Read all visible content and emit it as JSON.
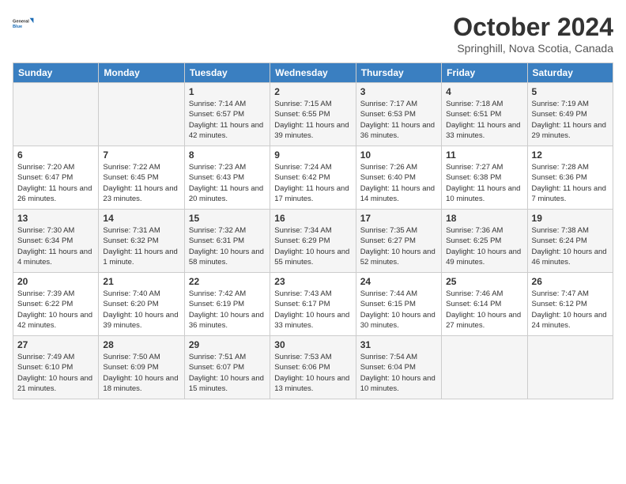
{
  "logo": {
    "line1": "General",
    "line2": "Blue"
  },
  "title": "October 2024",
  "subtitle": "Springhill, Nova Scotia, Canada",
  "days_of_week": [
    "Sunday",
    "Monday",
    "Tuesday",
    "Wednesday",
    "Thursday",
    "Friday",
    "Saturday"
  ],
  "weeks": [
    [
      {
        "day": "",
        "sunrise": "",
        "sunset": "",
        "daylight": ""
      },
      {
        "day": "",
        "sunrise": "",
        "sunset": "",
        "daylight": ""
      },
      {
        "day": "1",
        "sunrise": "Sunrise: 7:14 AM",
        "sunset": "Sunset: 6:57 PM",
        "daylight": "Daylight: 11 hours and 42 minutes."
      },
      {
        "day": "2",
        "sunrise": "Sunrise: 7:15 AM",
        "sunset": "Sunset: 6:55 PM",
        "daylight": "Daylight: 11 hours and 39 minutes."
      },
      {
        "day": "3",
        "sunrise": "Sunrise: 7:17 AM",
        "sunset": "Sunset: 6:53 PM",
        "daylight": "Daylight: 11 hours and 36 minutes."
      },
      {
        "day": "4",
        "sunrise": "Sunrise: 7:18 AM",
        "sunset": "Sunset: 6:51 PM",
        "daylight": "Daylight: 11 hours and 33 minutes."
      },
      {
        "day": "5",
        "sunrise": "Sunrise: 7:19 AM",
        "sunset": "Sunset: 6:49 PM",
        "daylight": "Daylight: 11 hours and 29 minutes."
      }
    ],
    [
      {
        "day": "6",
        "sunrise": "Sunrise: 7:20 AM",
        "sunset": "Sunset: 6:47 PM",
        "daylight": "Daylight: 11 hours and 26 minutes."
      },
      {
        "day": "7",
        "sunrise": "Sunrise: 7:22 AM",
        "sunset": "Sunset: 6:45 PM",
        "daylight": "Daylight: 11 hours and 23 minutes."
      },
      {
        "day": "8",
        "sunrise": "Sunrise: 7:23 AM",
        "sunset": "Sunset: 6:43 PM",
        "daylight": "Daylight: 11 hours and 20 minutes."
      },
      {
        "day": "9",
        "sunrise": "Sunrise: 7:24 AM",
        "sunset": "Sunset: 6:42 PM",
        "daylight": "Daylight: 11 hours and 17 minutes."
      },
      {
        "day": "10",
        "sunrise": "Sunrise: 7:26 AM",
        "sunset": "Sunset: 6:40 PM",
        "daylight": "Daylight: 11 hours and 14 minutes."
      },
      {
        "day": "11",
        "sunrise": "Sunrise: 7:27 AM",
        "sunset": "Sunset: 6:38 PM",
        "daylight": "Daylight: 11 hours and 10 minutes."
      },
      {
        "day": "12",
        "sunrise": "Sunrise: 7:28 AM",
        "sunset": "Sunset: 6:36 PM",
        "daylight": "Daylight: 11 hours and 7 minutes."
      }
    ],
    [
      {
        "day": "13",
        "sunrise": "Sunrise: 7:30 AM",
        "sunset": "Sunset: 6:34 PM",
        "daylight": "Daylight: 11 hours and 4 minutes."
      },
      {
        "day": "14",
        "sunrise": "Sunrise: 7:31 AM",
        "sunset": "Sunset: 6:32 PM",
        "daylight": "Daylight: 11 hours and 1 minute."
      },
      {
        "day": "15",
        "sunrise": "Sunrise: 7:32 AM",
        "sunset": "Sunset: 6:31 PM",
        "daylight": "Daylight: 10 hours and 58 minutes."
      },
      {
        "day": "16",
        "sunrise": "Sunrise: 7:34 AM",
        "sunset": "Sunset: 6:29 PM",
        "daylight": "Daylight: 10 hours and 55 minutes."
      },
      {
        "day": "17",
        "sunrise": "Sunrise: 7:35 AM",
        "sunset": "Sunset: 6:27 PM",
        "daylight": "Daylight: 10 hours and 52 minutes."
      },
      {
        "day": "18",
        "sunrise": "Sunrise: 7:36 AM",
        "sunset": "Sunset: 6:25 PM",
        "daylight": "Daylight: 10 hours and 49 minutes."
      },
      {
        "day": "19",
        "sunrise": "Sunrise: 7:38 AM",
        "sunset": "Sunset: 6:24 PM",
        "daylight": "Daylight: 10 hours and 46 minutes."
      }
    ],
    [
      {
        "day": "20",
        "sunrise": "Sunrise: 7:39 AM",
        "sunset": "Sunset: 6:22 PM",
        "daylight": "Daylight: 10 hours and 42 minutes."
      },
      {
        "day": "21",
        "sunrise": "Sunrise: 7:40 AM",
        "sunset": "Sunset: 6:20 PM",
        "daylight": "Daylight: 10 hours and 39 minutes."
      },
      {
        "day": "22",
        "sunrise": "Sunrise: 7:42 AM",
        "sunset": "Sunset: 6:19 PM",
        "daylight": "Daylight: 10 hours and 36 minutes."
      },
      {
        "day": "23",
        "sunrise": "Sunrise: 7:43 AM",
        "sunset": "Sunset: 6:17 PM",
        "daylight": "Daylight: 10 hours and 33 minutes."
      },
      {
        "day": "24",
        "sunrise": "Sunrise: 7:44 AM",
        "sunset": "Sunset: 6:15 PM",
        "daylight": "Daylight: 10 hours and 30 minutes."
      },
      {
        "day": "25",
        "sunrise": "Sunrise: 7:46 AM",
        "sunset": "Sunset: 6:14 PM",
        "daylight": "Daylight: 10 hours and 27 minutes."
      },
      {
        "day": "26",
        "sunrise": "Sunrise: 7:47 AM",
        "sunset": "Sunset: 6:12 PM",
        "daylight": "Daylight: 10 hours and 24 minutes."
      }
    ],
    [
      {
        "day": "27",
        "sunrise": "Sunrise: 7:49 AM",
        "sunset": "Sunset: 6:10 PM",
        "daylight": "Daylight: 10 hours and 21 minutes."
      },
      {
        "day": "28",
        "sunrise": "Sunrise: 7:50 AM",
        "sunset": "Sunset: 6:09 PM",
        "daylight": "Daylight: 10 hours and 18 minutes."
      },
      {
        "day": "29",
        "sunrise": "Sunrise: 7:51 AM",
        "sunset": "Sunset: 6:07 PM",
        "daylight": "Daylight: 10 hours and 15 minutes."
      },
      {
        "day": "30",
        "sunrise": "Sunrise: 7:53 AM",
        "sunset": "Sunset: 6:06 PM",
        "daylight": "Daylight: 10 hours and 13 minutes."
      },
      {
        "day": "31",
        "sunrise": "Sunrise: 7:54 AM",
        "sunset": "Sunset: 6:04 PM",
        "daylight": "Daylight: 10 hours and 10 minutes."
      },
      {
        "day": "",
        "sunrise": "",
        "sunset": "",
        "daylight": ""
      },
      {
        "day": "",
        "sunrise": "",
        "sunset": "",
        "daylight": ""
      }
    ]
  ]
}
